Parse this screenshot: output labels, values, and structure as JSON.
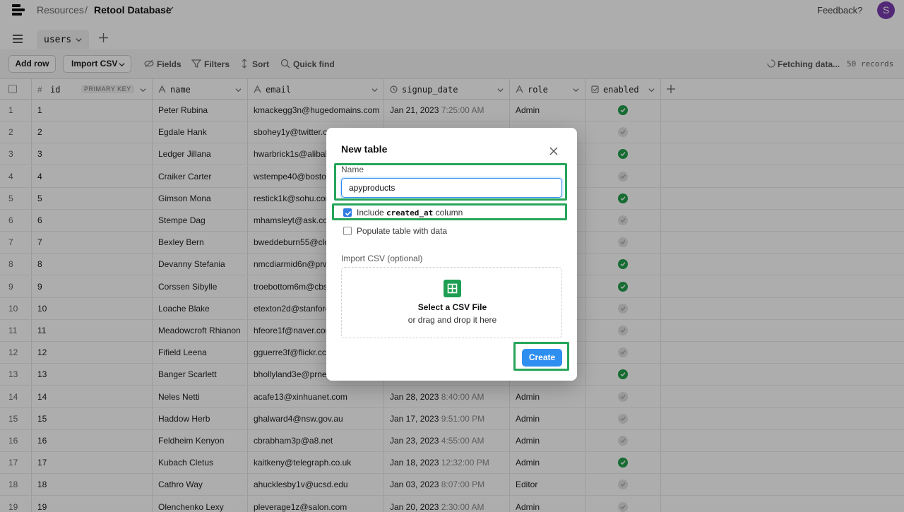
{
  "topbar": {
    "breadcrumb_resources": "Resources",
    "breadcrumb_separator": "/",
    "breadcrumb_database": "Retool Database",
    "feedback": "Feedback?",
    "avatar_initial": "S"
  },
  "tabs": {
    "active_tab": "users"
  },
  "toolbar": {
    "add_row": "Add row",
    "import_csv": "Import CSV",
    "fields": "Fields",
    "filters": "Filters",
    "sort": "Sort",
    "quick_find": "Quick find",
    "fetching": "Fetching data...",
    "records": "50 records"
  },
  "columns": {
    "id": "id",
    "primary_key": "PRIMARY KEY",
    "name": "name",
    "email": "email",
    "signup_date": "signup_date",
    "role": "role",
    "enabled": "enabled"
  },
  "rows": [
    {
      "num": "1",
      "id": "1",
      "name": "Peter Rubina",
      "email": "kmackegg3n@hugedomains.com",
      "date": "Jan 21, 2023",
      "time": "7:25:00 AM",
      "role": "Admin",
      "enabled": true
    },
    {
      "num": "2",
      "id": "2",
      "name": "Egdale Hank",
      "email": "sbohey1y@twitter.c",
      "date": "",
      "time": "",
      "role": "",
      "enabled": false
    },
    {
      "num": "3",
      "id": "3",
      "name": "Ledger Jillana",
      "email": "hwarbrick1s@alibab",
      "date": "",
      "time": "",
      "role": "",
      "enabled": true
    },
    {
      "num": "4",
      "id": "4",
      "name": "Craiker Carter",
      "email": "wstempe40@boston",
      "date": "",
      "time": "",
      "role": "",
      "enabled": false
    },
    {
      "num": "5",
      "id": "5",
      "name": "Gimson Mona",
      "email": "restick1k@sohu.cor",
      "date": "",
      "time": "",
      "role": "",
      "enabled": true
    },
    {
      "num": "6",
      "id": "6",
      "name": "Stempe Dag",
      "email": "mhamsleyt@ask.cor",
      "date": "",
      "time": "",
      "role": "",
      "enabled": false
    },
    {
      "num": "7",
      "id": "7",
      "name": "Bexley Bern",
      "email": "bweddeburn55@clo",
      "date": "",
      "time": "",
      "role": "",
      "enabled": false
    },
    {
      "num": "8",
      "id": "8",
      "name": "Devanny Stefania",
      "email": "nmcdiarmid6n@prw",
      "date": "",
      "time": "",
      "role": "",
      "enabled": true
    },
    {
      "num": "9",
      "id": "9",
      "name": "Corssen Sibylle",
      "email": "troebottom6m@cbs",
      "date": "",
      "time": "",
      "role": "",
      "enabled": true
    },
    {
      "num": "10",
      "id": "10",
      "name": "Loache Blake",
      "email": "etexton2d@stanforc",
      "date": "",
      "time": "",
      "role": "",
      "enabled": false
    },
    {
      "num": "11",
      "id": "11",
      "name": "Meadowcroft Rhianon",
      "email": "hfeore1f@naver.cor",
      "date": "",
      "time": "",
      "role": "",
      "enabled": false
    },
    {
      "num": "12",
      "id": "12",
      "name": "Fifield Leena",
      "email": "gguerre3f@flickr.cc",
      "date": "",
      "time": "",
      "role": "",
      "enabled": false
    },
    {
      "num": "13",
      "id": "13",
      "name": "Banger Scarlett",
      "email": "bhollyland3e@prnev",
      "date": "",
      "time": "",
      "role": "",
      "enabled": true
    },
    {
      "num": "14",
      "id": "14",
      "name": "Neles Netti",
      "email": "acafe13@xinhuanet.com",
      "date": "Jan 28, 2023",
      "time": "8:40:00 AM",
      "role": "Admin",
      "enabled": false
    },
    {
      "num": "15",
      "id": "15",
      "name": "Haddow Herb",
      "email": "ghalward4@nsw.gov.au",
      "date": "Jan 17, 2023",
      "time": "9:51:00 PM",
      "role": "Admin",
      "enabled": false
    },
    {
      "num": "16",
      "id": "16",
      "name": "Feldheim Kenyon",
      "email": "cbrabham3p@a8.net",
      "date": "Jan 23, 2023",
      "time": "4:55:00 AM",
      "role": "Admin",
      "enabled": false
    },
    {
      "num": "17",
      "id": "17",
      "name": "Kubach Cletus",
      "email": "kaitkeny@telegraph.co.uk",
      "date": "Jan 18, 2023",
      "time": "12:32:00 PM",
      "role": "Admin",
      "enabled": true
    },
    {
      "num": "18",
      "id": "18",
      "name": "Cathro Way",
      "email": "ahucklesby1v@ucsd.edu",
      "date": "Jan 03, 2023",
      "time": "8:07:00 PM",
      "role": "Editor",
      "enabled": false
    },
    {
      "num": "19",
      "id": "19",
      "name": "Olenchenko Lexy",
      "email": "pleverage1z@salon.com",
      "date": "Jan 20, 2023",
      "time": "2:30:00 AM",
      "role": "Admin",
      "enabled": false
    }
  ],
  "modal": {
    "title": "New table",
    "name_label": "Name",
    "name_value": "apyproducts",
    "include_prefix": "Include",
    "include_code": "created_at",
    "include_suffix": "column",
    "include_checked": true,
    "populate_label": "Populate table with data",
    "populate_checked": false,
    "import_label": "Import CSV (optional)",
    "dropzone_title": "Select a CSV File",
    "dropzone_subtitle": "or drag and drop it here",
    "create_button": "Create"
  },
  "colors": {
    "accent_blue": "#2f8ff0",
    "enabled_green": "#21a04a",
    "highlight_green": "#26a55a",
    "avatar_purple": "#7a3bb0"
  }
}
